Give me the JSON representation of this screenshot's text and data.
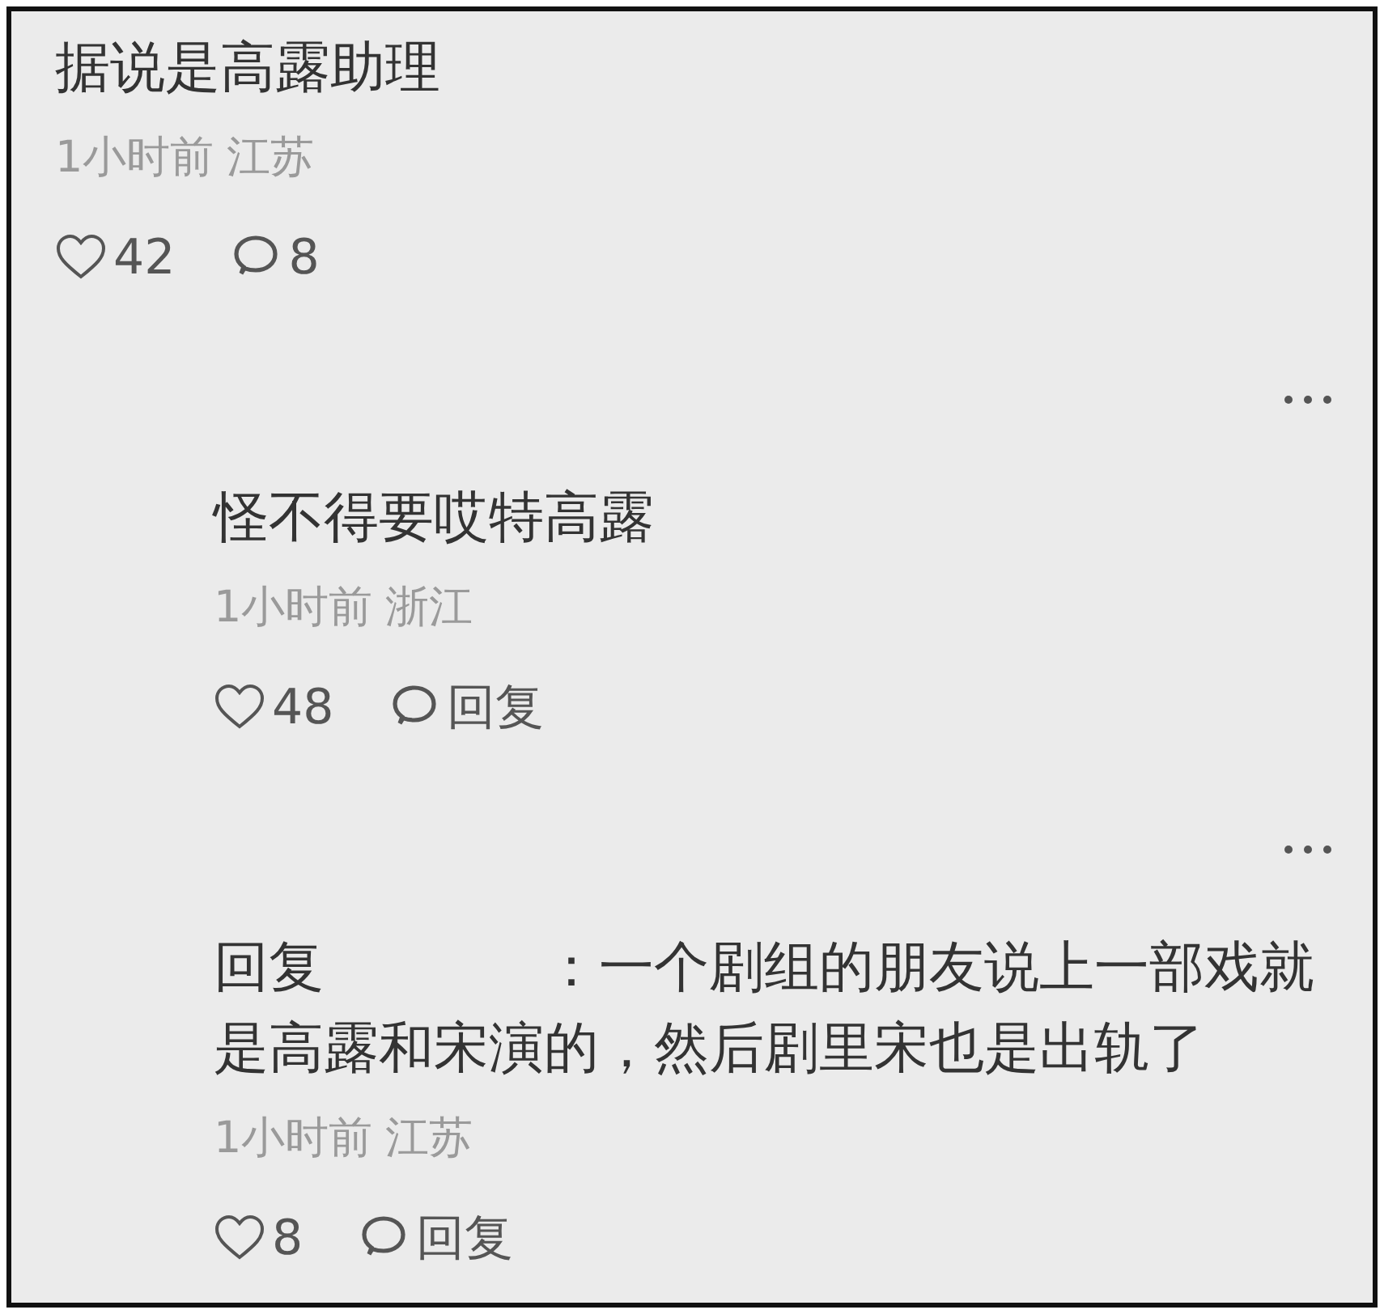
{
  "comments": [
    {
      "text": "据说是高露助理",
      "time": "1小时前",
      "location": "江苏",
      "likes": "42",
      "reply": "8",
      "children": [
        {
          "text": "怪不得要哎特高露",
          "time": "1小时前",
          "location": "浙江",
          "likes": "48",
          "reply": "回复"
        },
        {
          "text": "回复　　　　：一个剧组的朋友说上一部戏就是高露和宋演的，然后剧里宋也是出轨了",
          "time": "1小时前",
          "location": "江苏",
          "likes": "8",
          "reply": "回复"
        }
      ]
    }
  ]
}
